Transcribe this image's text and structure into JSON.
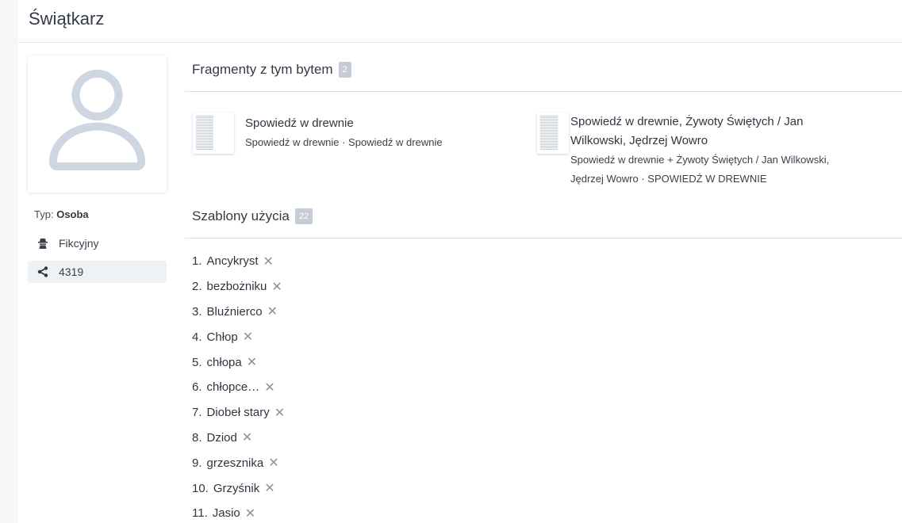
{
  "page": {
    "title": "Świątkarz"
  },
  "sidebar": {
    "type_prefix": "Typ:",
    "type_value": "Osoba",
    "fiction_label": "Fikcyjny",
    "id_label": "4319"
  },
  "fragments": {
    "heading": "Fragmenty z tym bytem",
    "count": "2",
    "items": [
      {
        "title": "Spowiedź w drewnie",
        "subtitle": "Spowiedź w drewnie · Spowiedź w drewnie"
      },
      {
        "title": "Spowiedź w drewnie, Żywoty Świętych / Jan Wilkowski, Jędrzej Wowro",
        "subtitle": "Spowiedź w drewnie + Żywoty Świętych / Jan Wilkowski, Jędrzej Wowro · SPOWIEDŹ W DREWNIE"
      }
    ]
  },
  "templates": {
    "heading": "Szablony użycia",
    "count": "22",
    "remove_glyph": "✕",
    "items": [
      {
        "num": "1.",
        "label": "Ancykryst"
      },
      {
        "num": "2.",
        "label": "bezbożniku"
      },
      {
        "num": "3.",
        "label": "Bluźnierco"
      },
      {
        "num": "4.",
        "label": "Chłop"
      },
      {
        "num": "5.",
        "label": "chłopa"
      },
      {
        "num": "6.",
        "label": "chłopce…"
      },
      {
        "num": "7.",
        "label": "Diobeł stary"
      },
      {
        "num": "8.",
        "label": "Dziod"
      },
      {
        "num": "9.",
        "label": "grzesznika"
      },
      {
        "num": "10.",
        "label": "Grzyśnik"
      },
      {
        "num": "11.",
        "label": "Jasio"
      }
    ]
  },
  "icons": {
    "avatar": "user-placeholder-icon",
    "fiction": "incognito-icon",
    "id": "share-node-icon"
  },
  "colors": {
    "avatar": "#cdd6e1",
    "badge": "#c5ccd6",
    "highlight_row": "#eef1f5"
  }
}
